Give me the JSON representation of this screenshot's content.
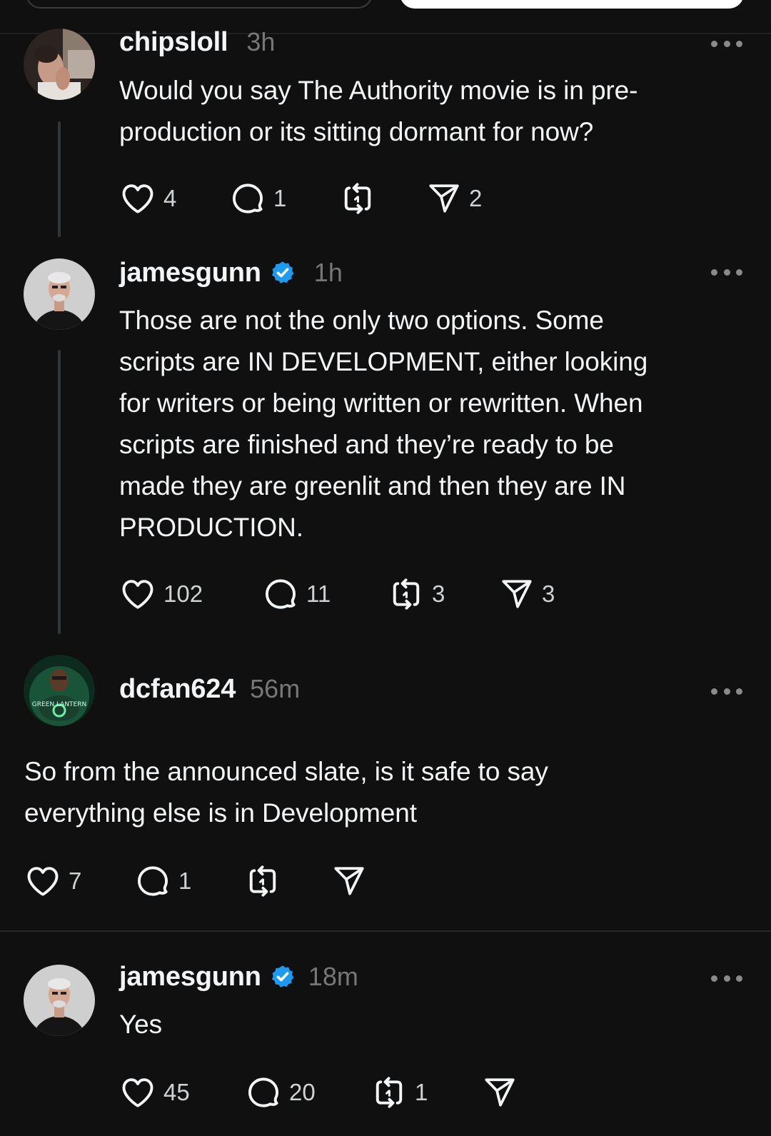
{
  "posts": [
    {
      "username": "chipsloll",
      "verified": false,
      "time": "3h",
      "text": [
        "Would you say The Authority movie is in pre-",
        "production or its sitting dormant for now?"
      ],
      "likes": "4",
      "replies": "1",
      "reposts": "",
      "shares": "2"
    },
    {
      "username": "jamesgunn",
      "verified": true,
      "time": "1h",
      "text": [
        "Those are not the only two options. Some",
        "scripts are IN DEVELOPMENT, either looking",
        "for writers or being written or rewritten. When",
        "scripts are finished and they’re ready to be",
        "made they are greenlit and then they are IN",
        "PRODUCTION."
      ],
      "likes": "102",
      "replies": "11",
      "reposts": "3",
      "shares": "3"
    },
    {
      "username": "dcfan624",
      "verified": false,
      "time": "56m",
      "text": [
        "So from the announced slate, is it safe to say",
        "everything else is in Development"
      ],
      "likes": "7",
      "replies": "1",
      "reposts": "",
      "shares": ""
    },
    {
      "username": "jamesgunn",
      "verified": true,
      "time": "18m",
      "text": [
        "Yes"
      ],
      "likes": "45",
      "replies": "20",
      "reposts": "1",
      "shares": ""
    }
  ],
  "avatar_text": "GREEN LANTERN",
  "icons": {
    "like": "heart-icon",
    "reply": "comment-bubble-icon",
    "repost": "repost-arrows-icon",
    "share": "send-paper-plane-icon",
    "verified": "verified-badge-icon",
    "more": "more-dots-icon"
  },
  "colors": {
    "background": "#101010",
    "text": "#f3f5f7",
    "muted": "#777777",
    "verified": "#1d9bf0"
  }
}
